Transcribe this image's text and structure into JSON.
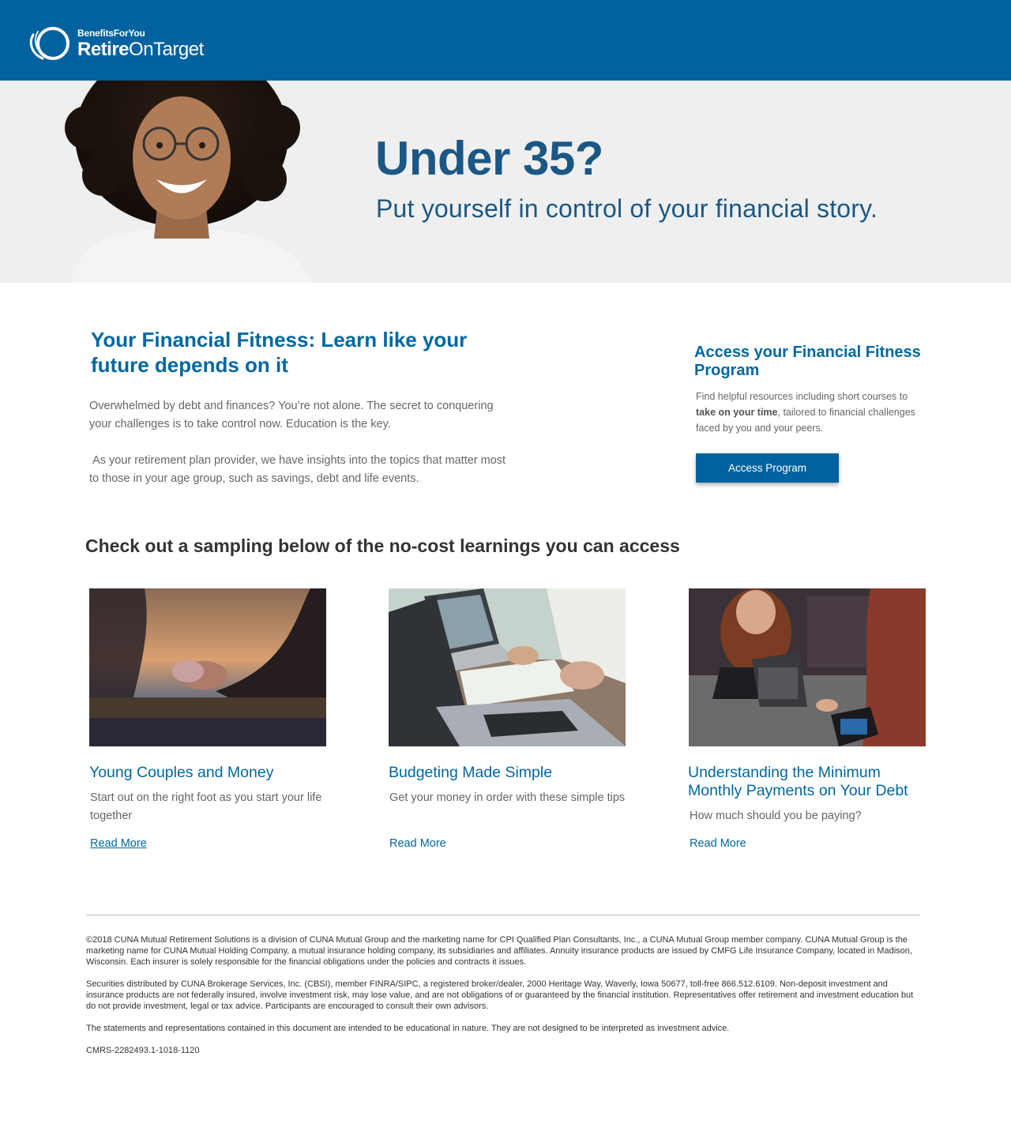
{
  "header": {
    "logo_small": "BenefitsForYou",
    "logo_brand_bold": "Retire",
    "logo_brand_rest": "OnTarget",
    "bg_color": "#00629e"
  },
  "hero": {
    "title": "Under 35?",
    "subtitle": "Put yourself in control of your financial story."
  },
  "intro": {
    "title": "Your Financial Fitness: Learn like your future depends on it",
    "paragraph1": "Overwhelmed by debt and finances? You’re not alone. The secret to conquering your challenges is to take control now. Education is the key.",
    "paragraph2": " As your retirement plan provider, we have insights into the topics that matter most to those in your age group, such as savings, debt and life events."
  },
  "sidebar": {
    "title": "Access your Financial Fitness Program",
    "text_before": "Find helpful resources including short courses to ",
    "text_bold": "take on your time",
    "text_after": ", tailored to financial challenges faced by you and your peers.",
    "button_label": "Access Program"
  },
  "sampling_heading": "Check out a sampling below of the no-cost learnings you can access",
  "cards": [
    {
      "title": "Young Couples and Money",
      "description": "Start out on the right foot as you start your life together",
      "link": "Read More",
      "image": "couple-holding-hands-photo"
    },
    {
      "title": "Budgeting Made Simple",
      "description": "Get your money in order with these simple tips",
      "link": "Read More",
      "image": "laptops-and-paperwork-photo"
    },
    {
      "title": "Understanding the Minimum Monthly Payments on Your Debt",
      "description": "How much should you be paying?",
      "link": "Read More",
      "image": "card-payment-at-counter-photo"
    }
  ],
  "footer": {
    "p1": "©2018 CUNA Mutual Retirement Solutions is a division of CUNA Mutual Group and the marketing name for CPI Qualified Plan Consultants, Inc., a CUNA Mutual Group member company. CUNA Mutual Group is the marketing name for CUNA Mutual Holding Company, a mutual insurance holding company, its subsidiaries and affiliates. Annuity insurance products are issued by CMFG Life Insurance Company, located in Madison, Wisconsin. Each insurer is solely responsible for the financial obligations under the policies and contracts it issues.",
    "p2": "Securities distributed by CUNA Brokerage Services, Inc. (CBSI), member FINRA/SIPC, a registered broker/dealer, 2000 Heritage Way, Waverly, Iowa 50677, toll-free 866.512.6109. Non-deposit investment and insurance products are not federally insured, involve investment risk, may lose value, and are not obligations of or guaranteed by the financial institution. Representatives offer retirement and investment education but do not provide investment, legal or tax advice. Participants are encouraged to consult their own advisors.",
    "p3": "The statements and representations contained in this document are intended to be educational in nature. They are not designed to be interpreted as investment advice.",
    "code": "CMRS-2282493.1-1018-1120"
  }
}
